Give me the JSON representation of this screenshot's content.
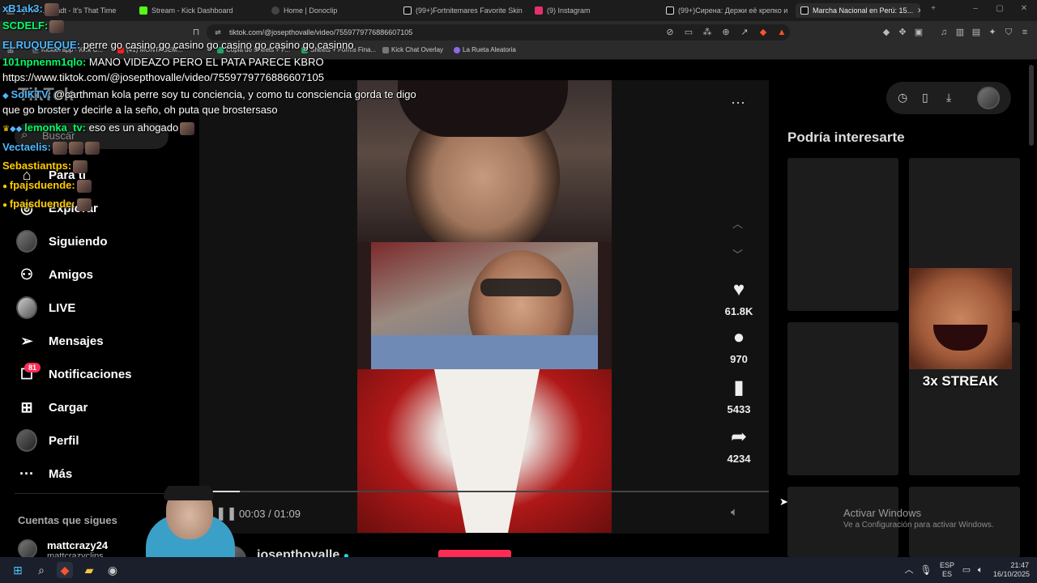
{
  "browser": {
    "tabs": [
      {
        "label": "by Ani... ffstadt - It's That Time",
        "color": "#6a6a6a"
      },
      {
        "label": "Stream - Kick Dashboard",
        "color": "#53fc18"
      },
      {
        "label": "Home | Donoclip",
        "color": "#888888"
      },
      {
        "label": "(99+)Fortnitemares Favorite Skin Re...",
        "color": "#ffffff"
      },
      {
        "label": "(9) Instagram",
        "color": "#e1306c"
      },
      {
        "label": "(99+)Сирена: Держи её крепко и н...",
        "color": "#ffffff"
      },
      {
        "label": "Marcha Nacional en Perú: 15...",
        "color": "#ffffff"
      }
    ],
    "new_tab_icon": "plus-icon",
    "url": "tiktok.com/@josepthovalle/video/7559779776886607105",
    "bookmarks": [
      {
        "label": "Kicklet.app - Kick C..."
      },
      {
        "label": "(41) MONTAGEM..."
      },
      {
        "label": "Copia de Sheets + F..."
      },
      {
        "label": "Sheets + Forms Fina..."
      },
      {
        "label": "Kick Chat Overlay"
      },
      {
        "label": "La Rueta Aleatoria"
      }
    ]
  },
  "tiktok": {
    "logo": "TikTok",
    "search_placeholder": "Buscar",
    "nav": [
      {
        "label": "Para ti",
        "icon": "home-icon"
      },
      {
        "label": "Explorar",
        "icon": "compass-icon"
      },
      {
        "label": "Siguiendo",
        "icon": "avatar-icon"
      },
      {
        "label": "Amigos",
        "icon": "friends-icon"
      },
      {
        "label": "LIVE",
        "icon": "live-icon"
      },
      {
        "label": "Mensajes",
        "icon": "send-icon"
      },
      {
        "label": "Notificaciones",
        "icon": "inbox-icon"
      },
      {
        "label": "Cargar",
        "icon": "upload-icon"
      },
      {
        "label": "Perfil",
        "icon": "profile-icon"
      },
      {
        "label": "Más",
        "icon": "more-icon"
      }
    ],
    "notifications_badge": "81",
    "following_header": "Cuentas que sigues",
    "following": [
      {
        "name": "mattcrazy24",
        "handle": "mattcrazyclips"
      }
    ],
    "video": {
      "author": "josepthovalle",
      "time_current": "00:03",
      "time_total": "01:09",
      "progress": 0.05,
      "likes": "61.8K",
      "comments": "970",
      "saves": "5433",
      "shares": "4234"
    },
    "sidebar_right_title": "Podría interesarte",
    "streak_label": "3x STREAK",
    "windows_watermark_title": "Activar Windows",
    "windows_watermark_sub": "Ve a Configuración para activar Windows."
  },
  "chat": [
    {
      "user": "xB1ak3:",
      "user_color": "#4db8ff",
      "text": ""
    },
    {
      "user": "SCDELF:",
      "user_color": "#00ff66",
      "text": ""
    },
    {
      "user": "ELRUQUEQUE:",
      "user_color": "#4db8ff",
      "text": " perre go casino go casino go casino go casino go casinno"
    },
    {
      "user": "101npnenm1qlo:",
      "user_color": "#00ff66",
      "text": " MANO VIDEAZO PERO EL PATA PARECE KBRO"
    },
    {
      "user": "",
      "user_color": "#ffffff",
      "text": "https://www.tiktok.com/@josepthovalle/video/7559779776886607105"
    },
    {
      "user": "SolKTV:",
      "user_color": "#4db8ff",
      "text": " @carthman kola perre soy tu conciencia, y como tu consciencia gorda te digo"
    },
    {
      "user": "",
      "user_color": "#ffffff",
      "text": "que go broster y decirle a la seño, oh puta que brostersaso"
    },
    {
      "user": "lemonka_tv:",
      "user_color": "#00ff66",
      "text": " eso es un ahogado"
    },
    {
      "user": "Vectaelis:",
      "user_color": "#4db8ff",
      "text": ""
    },
    {
      "user": "Sebastiantps:",
      "user_color": "#ffcc00",
      "text": ""
    },
    {
      "user": "fpajsduende:",
      "user_color": "#ffcc00",
      "text": ""
    },
    {
      "user": "fpajsduende:",
      "user_color": "#ffcc00",
      "text": ""
    }
  ],
  "taskbar": {
    "lang": "ESP",
    "lang_sub": "ES",
    "time": "21:47",
    "date": "16/10/2025"
  }
}
